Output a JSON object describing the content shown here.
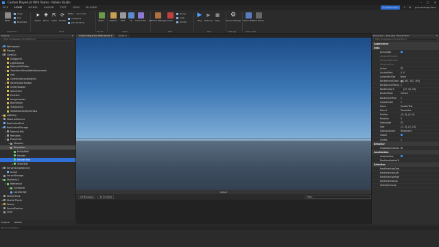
{
  "window": {
    "title": "Custom PlayerList With Teams - Roblox Studio"
  },
  "menu": {
    "items": [
      "FILE",
      "HOME",
      "MODEL",
      "AVATAR",
      "TEST",
      "VIEW",
      "PLUGINS"
    ],
    "collaborate": "Collaborate",
    "user": "pcbrandopullem"
  },
  "ribbon": {
    "clipboard": {
      "paste": "Paste",
      "copy": "Copy",
      "cut": "Cut",
      "duplicate": "Duplicate",
      "label": "Clipboard"
    },
    "tools": {
      "select": "Select",
      "move": "Move",
      "scale": "Scale",
      "rotate": "Rotate",
      "mode_label": "Mode:",
      "mode_value": "Geometric",
      "collisions": "Collisions",
      "join": "Join Surfaces",
      "label": "Tools"
    },
    "terrain": {
      "editor": "Editor",
      "label": "Terrain"
    },
    "insert": {
      "toolbox": "Toolbox",
      "part": "Part",
      "ui": "UI",
      "import3d": "Import 3D",
      "label": "Insert"
    },
    "file": {
      "label": "File"
    },
    "edit": {
      "material": "Material Manager",
      "color": "Color",
      "group": "Group",
      "lock": "Lock",
      "anchor": "Anchor",
      "label": "Edit"
    },
    "test": {
      "play": "Play",
      "resume": "Resume",
      "stop": "Stop",
      "label": "Test"
    },
    "settings": {
      "game": "Game Settings",
      "label": "Settings"
    },
    "team": {
      "team_test": "Team Test",
      "exit": "Exit Game",
      "label": "Team Test"
    }
  },
  "explorer": {
    "title": "Explorer",
    "filter_placeholder": "Filter workspace (Ctrl+Shift+X)",
    "tabs": [
      "Explorer",
      "TextBox"
    ],
    "items": [
      {
        "label": "Workspace",
        "depth": 0,
        "exp": "v",
        "color": "#4aa3ff"
      },
      {
        "label": "Players",
        "depth": 0,
        "exp": "",
        "color": "#e0a040"
      },
      {
        "label": "CoreGui",
        "depth": 0,
        "exp": "v",
        "color": "#9b9b9b"
      },
      {
        "label": "DraggerUI",
        "depth": 1,
        "exp": "",
        "color": "#e0c050"
      },
      {
        "label": "LightGuides",
        "depth": 1,
        "exp": "",
        "color": "#e0c050"
      },
      {
        "label": "RobloxGUIEditor",
        "depth": 1,
        "exp": ">",
        "color": "#e0c050"
      },
      {
        "label": "TransformTemplateAdornments",
        "depth": 1,
        "exp": ">",
        "color": "#e0c050"
      },
      {
        "label": "xlar",
        "depth": 1,
        "exp": "",
        "color": "#e0c050"
      },
      {
        "label": "CoreScriptLocalization",
        "depth": 1,
        "exp": "",
        "color": "#e0c050"
      },
      {
        "label": "SaveStudioToolbar",
        "depth": 1,
        "exp": ">",
        "color": "#e0c050"
      },
      {
        "label": "UtilityToolbar",
        "depth": 1,
        "exp": ">",
        "color": "#e0c050"
      },
      {
        "label": "SelectGUI",
        "depth": 1,
        "exp": "",
        "color": "#e0c050"
      },
      {
        "label": "EmitGui",
        "depth": 1,
        "exp": "",
        "color": "#e0c050"
      },
      {
        "label": "ImageLoader",
        "depth": 1,
        "exp": "",
        "color": "#e0c050"
      },
      {
        "label": "Boundings",
        "depth": 1,
        "exp": "",
        "color": "#e0c050"
      },
      {
        "label": "TeleportGui",
        "depth": 1,
        "exp": "",
        "color": "#e0c050"
      },
      {
        "label": "ViewSelectorScreenGui",
        "depth": 1,
        "exp": "",
        "color": "#e0c050"
      },
      {
        "label": "Lighting",
        "depth": 0,
        "exp": ">",
        "color": "#f0d040"
      },
      {
        "label": "MaterialService",
        "depth": 0,
        "exp": "",
        "color": "#9b9b9b"
      },
      {
        "label": "ReplicatedFirst",
        "depth": 0,
        "exp": "",
        "color": "#6ab0ff"
      },
      {
        "label": "ReplicatedStorage",
        "depth": 0,
        "exp": "v",
        "color": "#6ab0ff"
      },
      {
        "label": "ModuleUtils",
        "depth": 1,
        "exp": ">",
        "color": "#9b9b9b"
      },
      {
        "label": "Remotes",
        "depth": 1,
        "exp": ">",
        "color": "#9b9b9b"
      },
      {
        "label": "PlayerList",
        "depth": 1,
        "exp": "v",
        "color": "#9b9b9b"
      },
      {
        "label": "Modules",
        "depth": 2,
        "exp": ">",
        "color": "#9b9b9b"
      },
      {
        "label": "Templates",
        "depth": 2,
        "exp": "v",
        "color": "#9b9b9b",
        "hl": true
      },
      {
        "label": "EntityWell",
        "depth": 3,
        "exp": "",
        "color": "#6fcf6f"
      },
      {
        "label": "Header",
        "depth": 3,
        "exp": "",
        "color": "#6fcf6f"
      },
      {
        "label": "HeaderText",
        "depth": 3,
        "exp": "",
        "color": "#6fcf6f",
        "sel": true
      },
      {
        "label": "TeamText",
        "depth": 3,
        "exp": ">",
        "color": "#6fcf6f"
      },
      {
        "label": "ServerScriptService",
        "depth": 0,
        "exp": "v",
        "color": "#9b9b9b"
      },
      {
        "label": "Script",
        "depth": 1,
        "exp": "",
        "color": "#6ab0ff"
      },
      {
        "label": "ServerStorage",
        "depth": 0,
        "exp": "",
        "color": "#9b9b9b"
      },
      {
        "label": "StarterGui",
        "depth": 0,
        "exp": "v",
        "color": "#6fcf6f"
      },
      {
        "label": "Reference",
        "depth": 1,
        "exp": "v",
        "color": "#6fcf6f"
      },
      {
        "label": "Container",
        "depth": 2,
        "exp": ">",
        "color": "#6fcf6f"
      },
      {
        "label": "LocalScript",
        "depth": 2,
        "exp": "",
        "color": "#6ab0ff"
      },
      {
        "label": "StarterPack",
        "depth": 0,
        "exp": "",
        "color": "#9b9b9b"
      },
      {
        "label": "StarterPlayer",
        "depth": 0,
        "exp": ">",
        "color": "#9b9b9b"
      },
      {
        "label": "Teams",
        "depth": 0,
        "exp": ">",
        "color": "#e0a040"
      },
      {
        "label": "SoundService",
        "depth": 0,
        "exp": "",
        "color": "#9b9b9b"
      },
      {
        "label": "Chat",
        "depth": 0,
        "exp": "",
        "color": "#9b9b9b"
      }
    ]
  },
  "doc_tabs": [
    "Custom PlayerList With Teams",
    "Script"
  ],
  "output": {
    "title": "Output",
    "filter_messages": "All Messages",
    "filter_contexts": "All Contexts",
    "search_placeholder": "Filter..."
  },
  "properties": {
    "title": "Properties - TextLabel \"HeaderText\"",
    "filter_placeholder": "Filter Properties (Ctrl+Shift+P)",
    "sections": [
      {
        "name": "Appearance",
        "rows": []
      },
      {
        "name": "Data",
        "rows": [
          {
            "k": "Archivable",
            "v": "",
            "chk": true
          },
          {
            "k": "AbsolutePosition",
            "v": "",
            "dim": true
          },
          {
            "k": "AbsoluteRotation",
            "v": "",
            "dim": true
          },
          {
            "k": "AbsoluteSize",
            "v": "",
            "dim": true
          },
          {
            "k": "Active",
            "v": "",
            "chk": false
          },
          {
            "k": "AnchorPoint",
            "v": "0, 0"
          },
          {
            "k": "AutomaticSize",
            "v": "None"
          },
          {
            "k": "BackgroundColor3",
            "v": "[163, 162, 165]",
            "swatch": "#a3a2a5"
          },
          {
            "k": "BackgroundTransparency",
            "v": "1"
          },
          {
            "k": "BorderColor3",
            "v": "[27, 42, 53]",
            "swatch": "#1b2a35"
          },
          {
            "k": "BorderMode",
            "v": "Outline"
          },
          {
            "k": "BorderSizePixel",
            "v": "1"
          },
          {
            "k": "LayoutOrder",
            "v": "1"
          },
          {
            "k": "Name",
            "v": "HeaderText"
          },
          {
            "k": "Parent",
            "v": "Templates"
          },
          {
            "k": "Position",
            "v": "{0, 0},{0, 0}"
          },
          {
            "k": "Rotation",
            "v": "0"
          },
          {
            "k": "Selectable",
            "v": "",
            "chk": false
          },
          {
            "k": "Size",
            "v": "{1, 0},{0, 20}"
          },
          {
            "k": "SizeConstraint",
            "v": "RelativeXY"
          },
          {
            "k": "Visible",
            "v": "",
            "chk": true
          },
          {
            "k": "ZIndex",
            "v": "1"
          }
        ]
      },
      {
        "name": "Behavior",
        "rows": [
          {
            "k": "ClipsDescendants",
            "v": "",
            "chk": false
          }
        ]
      },
      {
        "name": "Localization",
        "rows": [
          {
            "k": "AutoLocalize",
            "v": "",
            "chk": true
          },
          {
            "k": "RootLocalizationTable",
            "v": ""
          }
        ]
      },
      {
        "name": "Selection",
        "rows": [
          {
            "k": "NextSelectionDown",
            "v": ""
          },
          {
            "k": "NextSelectionLeft",
            "v": ""
          },
          {
            "k": "NextSelectionRight",
            "v": ""
          },
          {
            "k": "NextSelectionUp",
            "v": ""
          },
          {
            "k": "SelectionGroup",
            "v": ""
          }
        ]
      }
    ]
  },
  "command_bar": {
    "placeholder": "Run a command"
  }
}
